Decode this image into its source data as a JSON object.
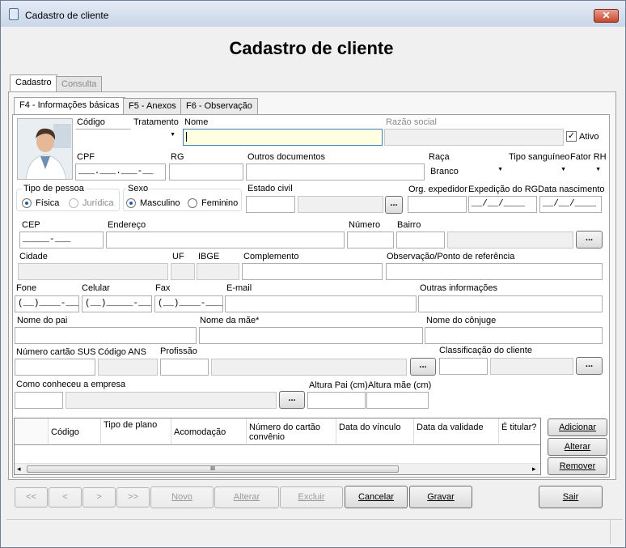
{
  "window": {
    "title": "Cadastro de cliente",
    "close_label": "✕"
  },
  "heading": "Cadastro de cliente",
  "main_tabs": [
    {
      "label": "Cadastro"
    },
    {
      "label": "Consulta"
    }
  ],
  "sub_tabs": [
    {
      "label": "F4 - Informações básicas"
    },
    {
      "label": "F5 - Anexos"
    },
    {
      "label": "F6 - Observação"
    }
  ],
  "labels": {
    "codigo": "Código",
    "tratamento": "Tratamento",
    "nome": "Nome",
    "razao_social": "Razão social",
    "ativo": "Ativo",
    "cpf": "CPF",
    "rg": "RG",
    "outros_documentos": "Outros documentos",
    "raca": "Raça",
    "tipo_sanguineo": "Tipo sanguíneo",
    "fator_rh": "Fator RH",
    "tipo_pessoa": "Tipo de pessoa",
    "fisica": "Física",
    "juridica": "Jurídica",
    "sexo": "Sexo",
    "masculino": "Masculino",
    "feminino": "Feminino",
    "estado_civil": "Estado civil",
    "org_expedidor": "Org. expedidor",
    "expedicao_rg": "Expedição do RG",
    "data_nascimento": "Data nascimento",
    "cep": "CEP",
    "endereco": "Endereço",
    "numero": "Número",
    "bairro": "Bairro",
    "cidade": "Cidade",
    "uf": "UF",
    "ibge": "IBGE",
    "complemento": "Complemento",
    "observacao": "Observação/Ponto de referência",
    "fone": "Fone",
    "celular": "Celular",
    "fax": "Fax",
    "email": "E-mail",
    "outras_informacoes": "Outras informações",
    "nome_pai": "Nome do pai",
    "nome_mae": "Nome da mãe*",
    "nome_conjuge": "Nome do cônjuge",
    "numero_sus": "Número cartão SUS",
    "codigo_ans": "Código ANS",
    "profissao": "Profissão",
    "classificacao": "Classificação do cliente",
    "como_conheceu": "Como conheceu a empresa",
    "altura_pai": "Altura Pai (cm)",
    "altura_mae": "Altura mãe (cm)"
  },
  "values": {
    "cpf": "___.___.___-__",
    "raca": "Branco",
    "cep": "_____-___",
    "expedicao_rg": "__/__/____",
    "data_nascimento": "__/__/____",
    "fone": "(__)____-____",
    "celular": "(__)_____-____",
    "fax": "(__)____-____",
    "dots": "..."
  },
  "table": {
    "columns": [
      "Código",
      "Tipo de plano",
      "Acomodação",
      "Número do cartão convênio",
      "Data do vínculo",
      "Data da validade",
      "É titular?"
    ],
    "scroll_thumb": "III",
    "scroll_left": "◂",
    "scroll_right": "▸"
  },
  "table_buttons": {
    "add": "Adicionar",
    "edit": "Alterar",
    "remove": "Remover"
  },
  "nav": {
    "first": "<<",
    "prev": "<",
    "next": ">",
    "last": ">>"
  },
  "actions": {
    "novo": "Novo",
    "alterar": "Alterar",
    "excluir": "Excluir",
    "cancelar": "Cancelar",
    "gravar": "Gravar",
    "sair": "Sair"
  },
  "colors": {
    "accent": "#3c7fb1",
    "title_gradient_top": "#e4ebf5",
    "close_red": "#c8462e"
  }
}
